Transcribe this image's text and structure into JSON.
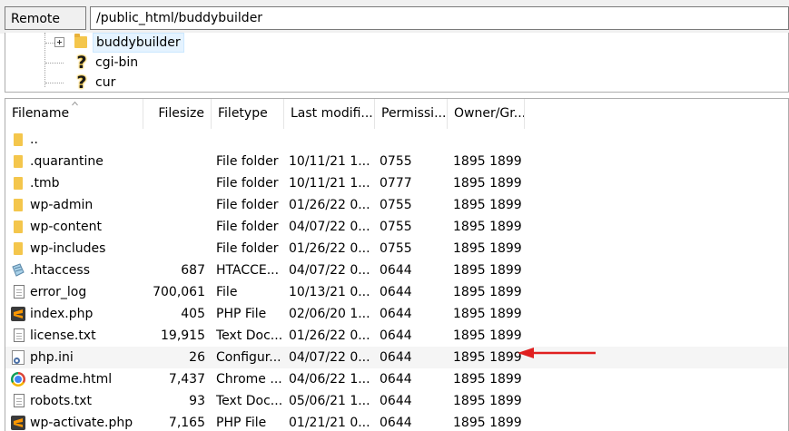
{
  "remote_site": {
    "label": "Remote site:",
    "path": "/public_html/buddybuilder"
  },
  "tree": {
    "items": [
      {
        "label": "buddybuilder",
        "icon": "folder-icon",
        "selected": true,
        "expandable": true
      },
      {
        "label": "cgi-bin",
        "icon": "unknown-folder-icon",
        "selected": false,
        "expandable": false
      },
      {
        "label": "cur",
        "icon": "unknown-folder-icon",
        "selected": false,
        "expandable": false
      }
    ],
    "unknown_glyph": "?"
  },
  "listing": {
    "columns": [
      "Filename",
      "Filesize",
      "Filetype",
      "Last modifi...",
      "Permissi...",
      "Owner/Gr..."
    ],
    "sort_column": "Filename",
    "rows": [
      {
        "name": "..",
        "size": "",
        "type": "",
        "modified": "",
        "perm": "",
        "owner": "",
        "icon": "folder-icon"
      },
      {
        "name": ".quarantine",
        "size": "",
        "type": "File folder",
        "modified": "10/11/21 1...",
        "perm": "0755",
        "owner": "1895 1899",
        "icon": "folder-icon"
      },
      {
        "name": ".tmb",
        "size": "",
        "type": "File folder",
        "modified": "10/11/21 1...",
        "perm": "0777",
        "owner": "1895 1899",
        "icon": "folder-icon"
      },
      {
        "name": "wp-admin",
        "size": "",
        "type": "File folder",
        "modified": "01/26/22 0...",
        "perm": "0755",
        "owner": "1895 1899",
        "icon": "folder-icon"
      },
      {
        "name": "wp-content",
        "size": "",
        "type": "File folder",
        "modified": "04/07/22 0...",
        "perm": "0755",
        "owner": "1895 1899",
        "icon": "folder-icon"
      },
      {
        "name": "wp-includes",
        "size": "",
        "type": "File folder",
        "modified": "01/26/22 0...",
        "perm": "0755",
        "owner": "1895 1899",
        "icon": "folder-icon"
      },
      {
        "name": ".htaccess",
        "size": "687",
        "type": "HTACCE...",
        "modified": "04/07/22 0...",
        "perm": "0644",
        "owner": "1895 1899",
        "icon": "htaccess-icon"
      },
      {
        "name": "error_log",
        "size": "700,061",
        "type": "File",
        "modified": "10/13/21 0...",
        "perm": "0644",
        "owner": "1895 1899",
        "icon": "document-icon"
      },
      {
        "name": "index.php",
        "size": "405",
        "type": "PHP File",
        "modified": "02/06/20 1...",
        "perm": "0644",
        "owner": "1895 1899",
        "icon": "sublime-text-icon"
      },
      {
        "name": "license.txt",
        "size": "19,915",
        "type": "Text Doc...",
        "modified": "01/26/22 0...",
        "perm": "0644",
        "owner": "1895 1899",
        "icon": "document-icon"
      },
      {
        "name": "php.ini",
        "size": "26",
        "type": "Configur...",
        "modified": "04/07/22 0...",
        "perm": "0644",
        "owner": "1895 1899",
        "icon": "config-file-icon",
        "highlighted": true
      },
      {
        "name": "readme.html",
        "size": "7,437",
        "type": "Chrome ...",
        "modified": "04/06/22 1...",
        "perm": "0644",
        "owner": "1895 1899",
        "icon": "chrome-icon"
      },
      {
        "name": "robots.txt",
        "size": "93",
        "type": "Text Doc...",
        "modified": "05/06/21 1...",
        "perm": "0644",
        "owner": "1895 1899",
        "icon": "document-icon"
      },
      {
        "name": "wp-activate.php",
        "size": "7,165",
        "type": "PHP File",
        "modified": "01/21/21 0...",
        "perm": "0644",
        "owner": "1895 1899",
        "icon": "sublime-text-icon"
      }
    ]
  },
  "annotation": {
    "color": "#e02020",
    "points_to": "php.ini"
  }
}
